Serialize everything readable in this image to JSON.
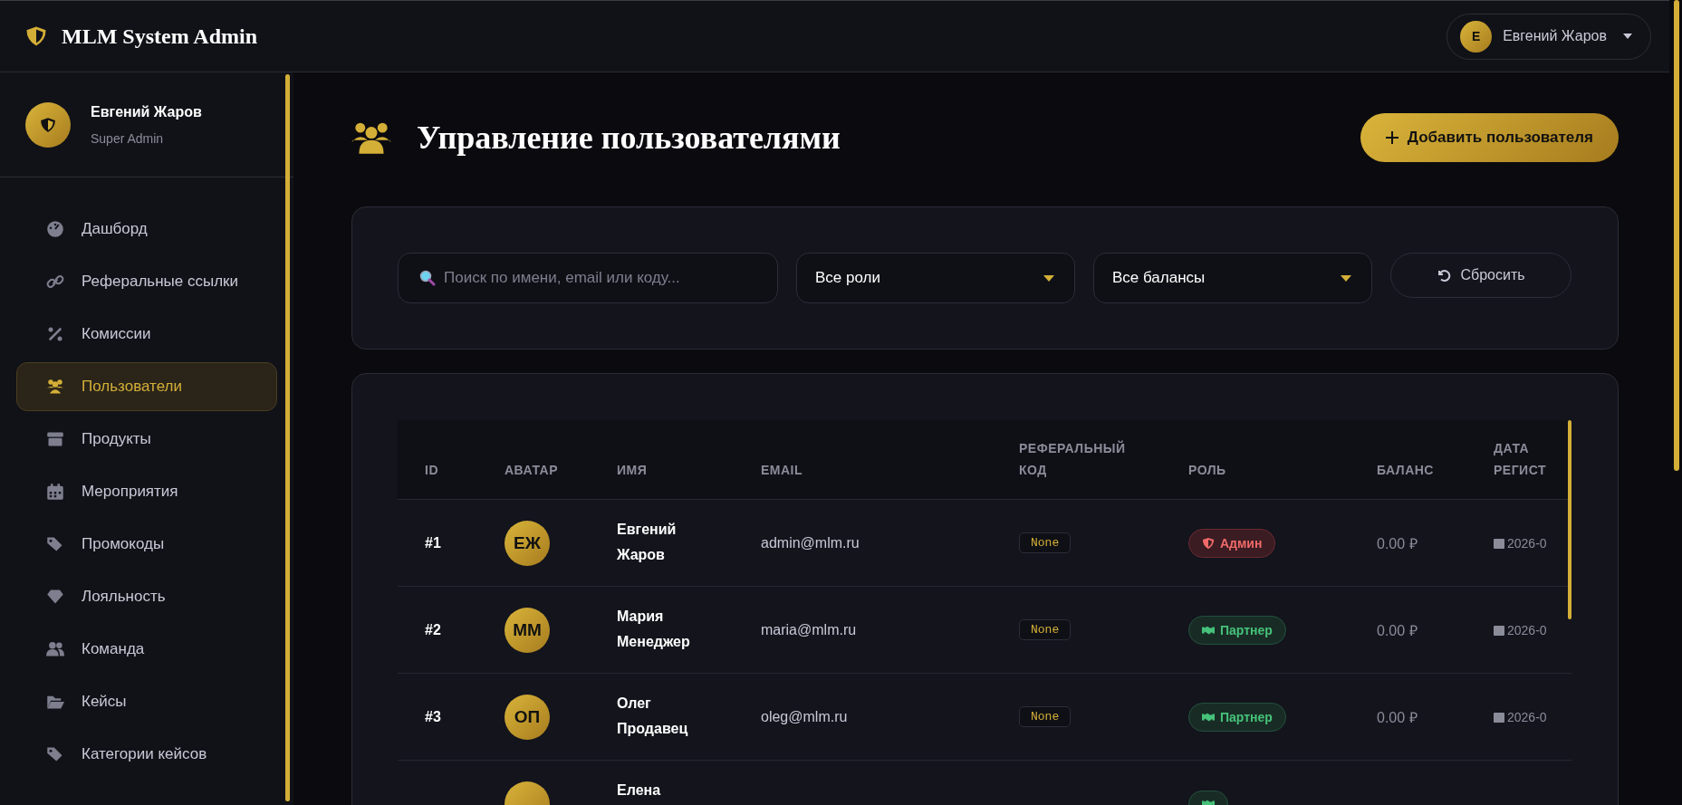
{
  "header": {
    "logo": "MLM System Admin",
    "user_menu": {
      "initial": "Е",
      "name": "Евгений Жаров"
    }
  },
  "sidebar": {
    "profile": {
      "name": "Евгений Жаров",
      "role": "Super Admin"
    },
    "items": [
      {
        "label": "Дашборд",
        "selected": false
      },
      {
        "label": "Реферальные ссылки",
        "selected": false
      },
      {
        "label": "Комиссии",
        "selected": false
      },
      {
        "label": "Пользователи",
        "selected": true
      },
      {
        "label": "Продукты",
        "selected": false
      },
      {
        "label": "Мероприятия",
        "selected": false
      },
      {
        "label": "Промокоды",
        "selected": false
      },
      {
        "label": "Лояльность",
        "selected": false
      },
      {
        "label": "Команда",
        "selected": false
      },
      {
        "label": "Кейсы",
        "selected": false
      },
      {
        "label": "Категории кейсов",
        "selected": false
      }
    ]
  },
  "page": {
    "title": "Управление пользователями",
    "add_button": "Добавить пользователя"
  },
  "filters": {
    "search": {
      "placeholder": "Поиск по имени, email или коду..."
    },
    "selects": [
      "Все роли",
      "Все балансы"
    ],
    "reset": "Сбросить"
  },
  "table": {
    "columns": [
      "ID",
      "АВАТАР",
      "ИМЯ",
      "EMAIL",
      "РЕФЕРАЛЬНЫЙ КОД",
      "РОЛЬ",
      "БАЛАНС",
      "ДАТА РЕГИСТ"
    ],
    "rows": [
      {
        "id": "#1",
        "initials": "ЕЖ",
        "name": "Евгений Жаров",
        "email": "admin@mlm.ru",
        "code": "None",
        "role": {
          "kind": "admin",
          "label": "Админ"
        },
        "balance": "0.00 ₽",
        "date": "2026-0"
      },
      {
        "id": "#2",
        "initials": "ММ",
        "name": "Мария Менеджер",
        "email": "maria@mlm.ru",
        "code": "None",
        "role": {
          "kind": "partner",
          "label": "Партнер"
        },
        "balance": "0.00 ₽",
        "date": "2026-0"
      },
      {
        "id": "#3",
        "initials": "ОП",
        "name": "Олег Продавец",
        "email": "oleg@mlm.ru",
        "code": "None",
        "role": {
          "kind": "partner",
          "label": "Партнер"
        },
        "balance": "0.00 ₽",
        "date": "2026-0"
      },
      {
        "name": "Елена",
        "role": {
          "kind": "partner"
        }
      }
    ]
  }
}
